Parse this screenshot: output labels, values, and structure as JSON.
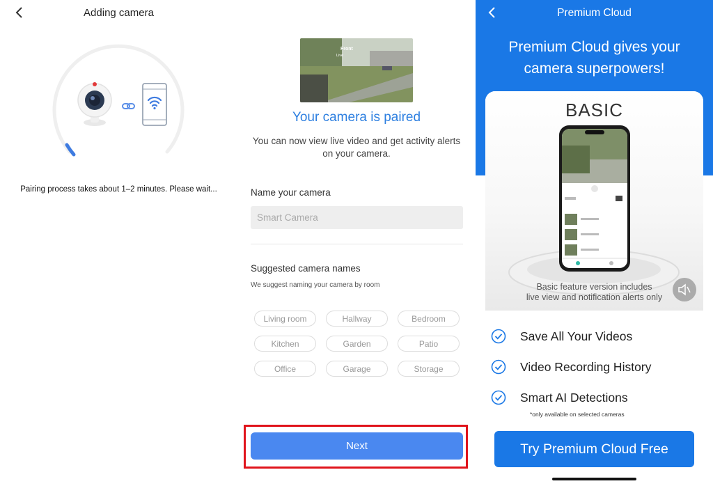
{
  "colors": {
    "accent": "#2d7fe0",
    "premium_blue": "#1a78e6",
    "highlight_red": "#e0141c",
    "next_button": "#4a88f0"
  },
  "pairing": {
    "title": "Adding camera",
    "back_icon": "chevron-left-icon",
    "status_text": "Pairing process takes about 1–2 minutes. Please wait..."
  },
  "paired": {
    "thumbnail_overlay_title": "Front",
    "thumbnail_overlay_sub": "Live",
    "heading": "Your camera is paired",
    "description": "You can now view live video and get activity alerts on your camera.",
    "name_label": "Name your camera",
    "name_placeholder": "Smart Camera",
    "name_value": "",
    "suggested_title": "Suggested camera names",
    "suggested_subtitle": "We suggest naming your camera by room",
    "suggestions": [
      "Living room",
      "Hallway",
      "Bedroom",
      "Kitchen",
      "Garden",
      "Patio",
      "Office",
      "Garage",
      "Storage"
    ],
    "next_label": "Next"
  },
  "premium": {
    "nav_title": "Premium Cloud",
    "back_icon": "chevron-left-icon",
    "hero_line1": "Premium Cloud gives your",
    "hero_line2": "camera superpowers!",
    "tier_label": "BASIC",
    "caption_line1": "Basic feature version includes",
    "caption_line2": "live view and notification alerts only",
    "features": [
      "Save All Your Videos",
      "Video Recording History",
      "Smart AI Detections"
    ],
    "note": "*only available on selected cameras",
    "cta_label": "Try Premium Cloud Free"
  }
}
